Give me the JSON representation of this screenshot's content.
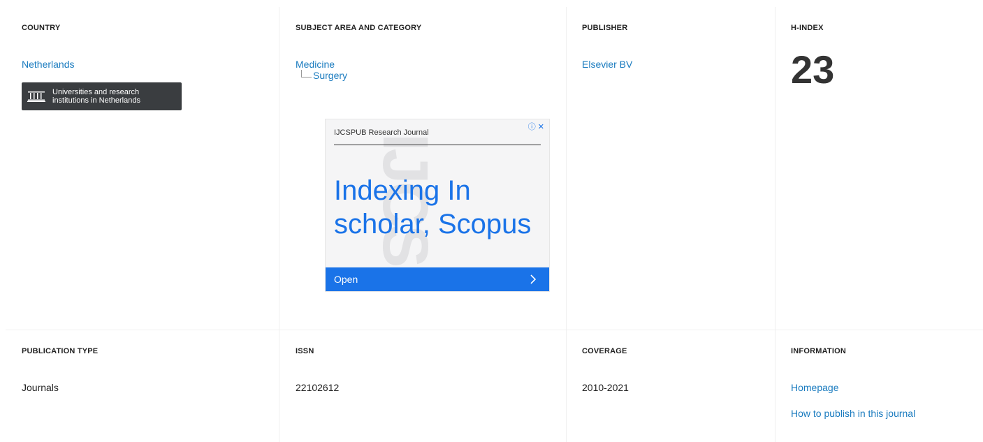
{
  "country": {
    "heading": "Country",
    "value": "Netherlands",
    "institutions_line1": "Universities and research",
    "institutions_line2": "institutions in Netherlands"
  },
  "subject": {
    "heading": "Subject Area and Category",
    "area": "Medicine",
    "category": "Surgery"
  },
  "publisher": {
    "heading": "Publisher",
    "value": "Elsevier BV"
  },
  "hindex": {
    "heading": "H-Index",
    "value": "23"
  },
  "ad": {
    "brand": "IJCSPUB Research Journal",
    "headline_line1": "Indexing In",
    "headline_line2": "scholar, Scopus",
    "cta": "Open",
    "accent": "#1a73e8"
  },
  "publication_type": {
    "heading": "Publication type",
    "value": "Journals"
  },
  "issn": {
    "heading": "ISSN",
    "value": "22102612"
  },
  "coverage": {
    "heading": "Coverage",
    "value": "2010-2021"
  },
  "information": {
    "heading": "Information",
    "homepage": "Homepage",
    "how_to_publish": "How to publish in this journal"
  },
  "colors": {
    "link": "#1a7bbf",
    "dark_button": "#3a3d40"
  }
}
